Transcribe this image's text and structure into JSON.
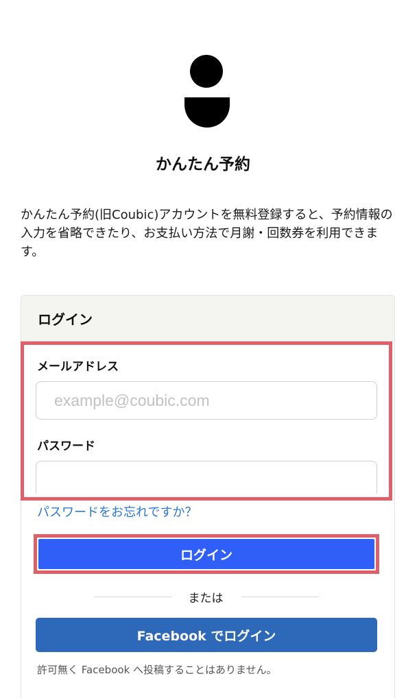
{
  "app": {
    "title": "かんたん予約",
    "intro": "かんたん予約(旧Coubic)アカウントを無料登録すると、予約情報の入力を省略できたり、お支払い方法で月謝・回数券を利用できます。"
  },
  "login_card": {
    "header": "ログイン",
    "email_label": "メールアドレス",
    "email_placeholder": "example@coubic.com",
    "email_value": "",
    "password_label": "パスワード",
    "password_value": "",
    "forgot_link": "パスワードをお忘れですか？",
    "login_button": "ログイン",
    "divider": "または",
    "facebook_button": "Facebook でログイン",
    "facebook_note": "許可無く Facebook へ投稿することはありません。"
  },
  "colors": {
    "highlight": "#e06069",
    "login_button": "#2f5ff6",
    "facebook_button": "#2d68b9",
    "link": "#2c78d6"
  }
}
